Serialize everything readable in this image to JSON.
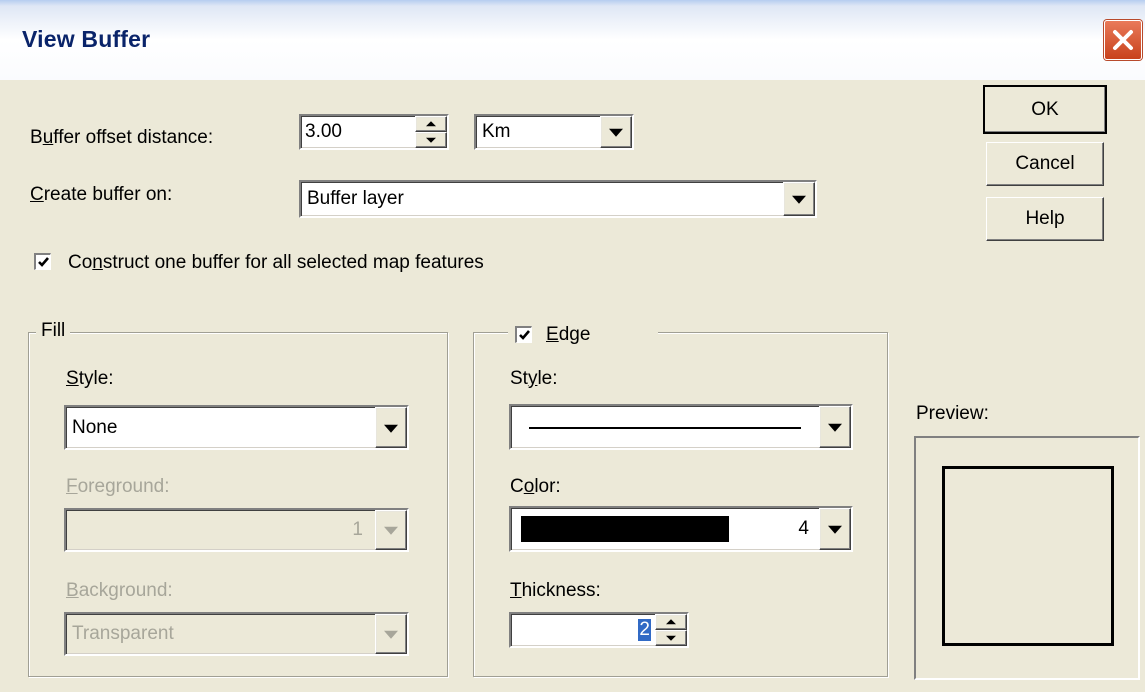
{
  "window": {
    "title": "View Buffer",
    "close_icon": "close-icon"
  },
  "buttons": {
    "ok": "OK",
    "cancel": "Cancel",
    "help": "Help"
  },
  "offset": {
    "label_pre": "B",
    "label_u": "u",
    "label_post": "ffer offset distance:",
    "value": "3.00",
    "unit": "Km"
  },
  "create_on": {
    "label_u": "C",
    "label_post": "reate buffer on:",
    "value": "Buffer layer"
  },
  "construct_one": {
    "checked": true,
    "label_pre": "Co",
    "label_u": "n",
    "label_post": "struct one buffer for all selected map features"
  },
  "fill": {
    "legend": "Fill",
    "style_label_u": "S",
    "style_label_post": "tyle:",
    "style_value": "None",
    "foreground_label_u": "F",
    "foreground_label_post": "oreground:",
    "foreground_value": "1",
    "background_label_u": "B",
    "background_label_post": "ackground:",
    "background_value": "Transparent"
  },
  "edge": {
    "checked": true,
    "legend_u": "E",
    "legend_post": "dge",
    "style_label_pre": "St",
    "style_label_u": "y",
    "style_label_post": "le:",
    "color_label_pre": "C",
    "color_label_u": "o",
    "color_label_post": "lor:",
    "color_value": "4",
    "color_swatch": "#000000",
    "thickness_label_u": "T",
    "thickness_label_post": "hickness:",
    "thickness_value": "2"
  },
  "preview": {
    "label": "Preview:"
  },
  "colors": {
    "face": "#ece9d8",
    "title_text": "#0a246a",
    "disabled_text": "#a7a69a",
    "selection": "#316ac5"
  }
}
